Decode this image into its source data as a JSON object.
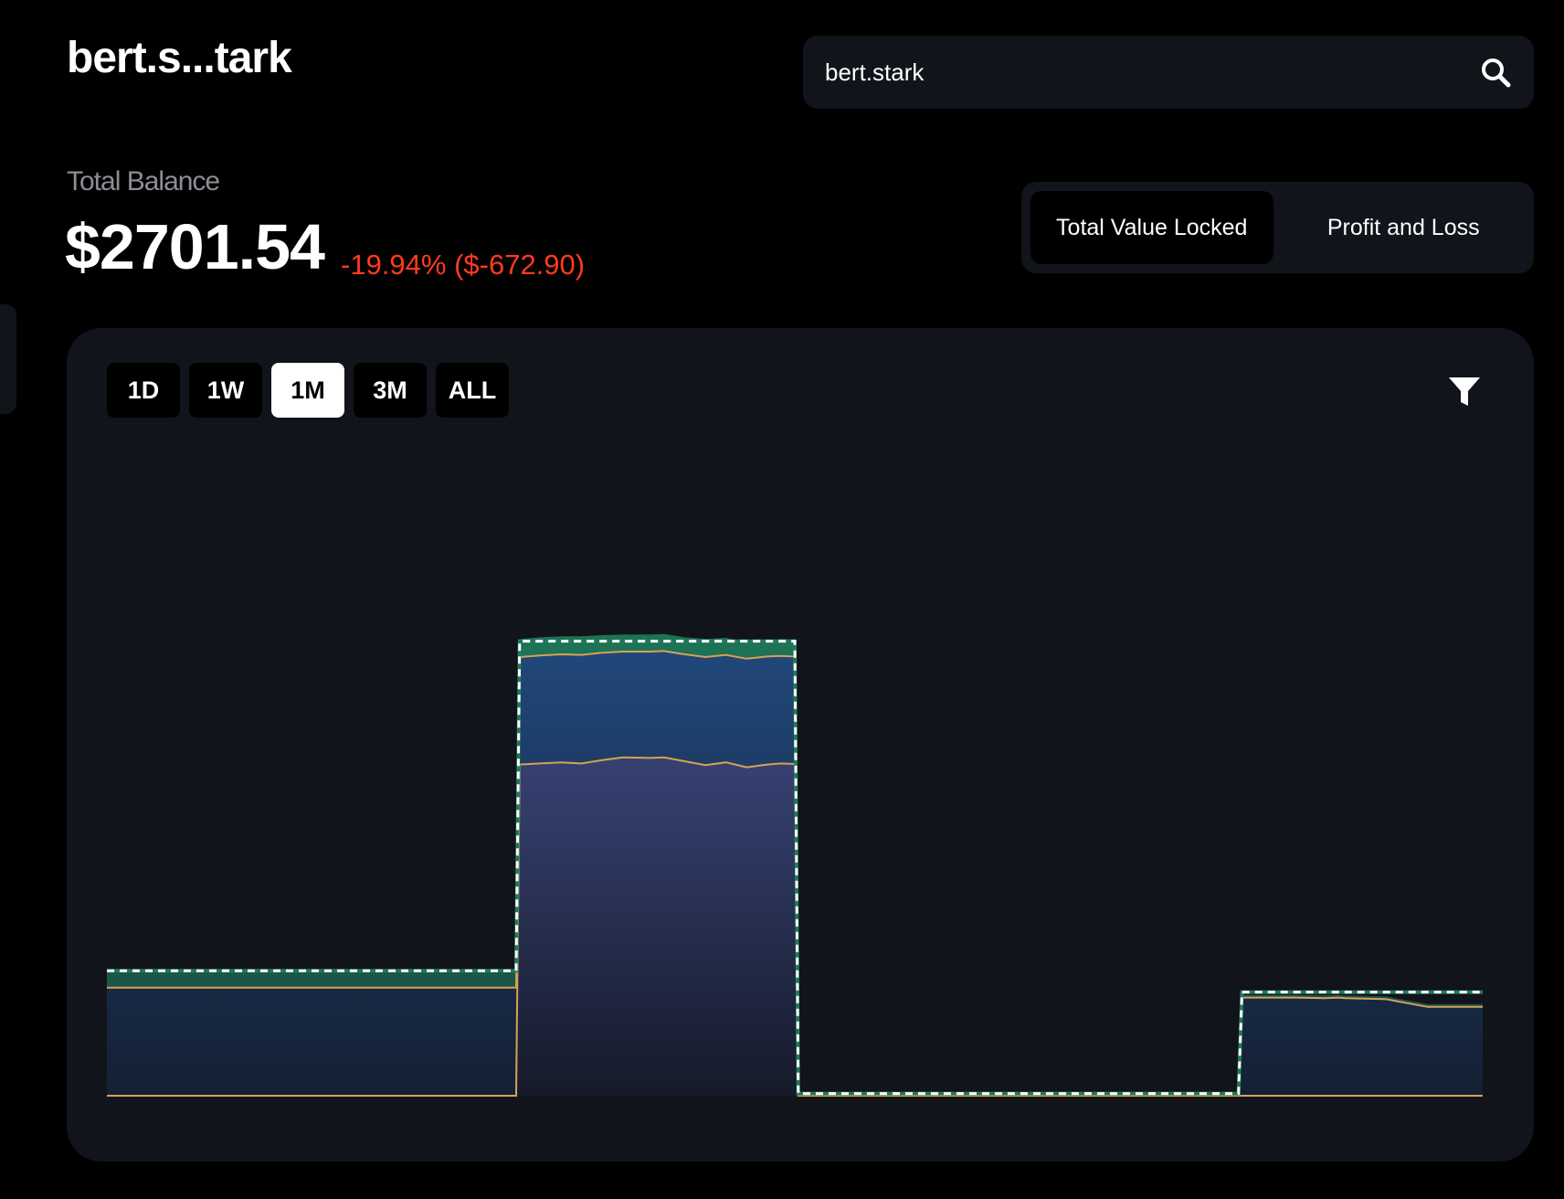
{
  "header": {
    "account_title": "bert.s...tark",
    "search": {
      "value": "bert.stark",
      "icon": "search-icon"
    }
  },
  "balance": {
    "label": "Total Balance",
    "value": "$2701.54",
    "change": "-19.94% ($-672.90)",
    "change_color": "#ff3b1f"
  },
  "view_toggle": {
    "options": [
      "Total Value Locked",
      "Profit and Loss"
    ],
    "selected": "Total Value Locked"
  },
  "ranges": {
    "options": [
      "1D",
      "1W",
      "1M",
      "3M",
      "ALL"
    ],
    "selected": "1M"
  },
  "filter": {
    "icon": "filter-icon"
  },
  "colors": {
    "background": "#000000",
    "card": "#11141a",
    "layer_green": "#1f7a5a",
    "layer_blue": "#24508a",
    "layer_indigo": "#4a5aa0",
    "line_orange": "#d6a255",
    "total_line": "#ffffff"
  },
  "chart_data": {
    "type": "area",
    "stacked": true,
    "x_axis_labels_shown": false,
    "y_axis_labels_shown": false,
    "grid": false,
    "legend": "none",
    "ylim": [
      0,
      100
    ],
    "x": [
      0,
      0.3,
      0.55,
      0.8,
      1,
      1.6,
      2.8,
      3.3,
      3.4,
      3.45,
      3.95,
      4.4,
      4.65,
      4.9,
      5,
      5.25,
      5.45,
      5.7,
      5.95,
      6,
      6.3,
      6.6,
      6.9,
      7.2,
      7.5,
      7.9,
      8.1,
      8.4,
      8.7,
      9,
      9.3,
      9.6,
      9.8,
      10,
      10.05,
      10.4,
      10.8,
      11.3,
      12,
      13,
      14,
      15,
      16,
      16.45,
      16.5,
      16.9,
      17.3,
      17.7,
      17.9,
      18,
      18.3,
      18.6,
      19.2,
      19.6,
      19.7,
      20
    ],
    "series": [
      {
        "values": [
          0,
          0,
          0,
          0,
          0,
          0,
          0,
          0,
          0,
          0,
          0,
          0,
          0,
          0,
          0,
          0,
          0,
          0,
          0,
          60.4,
          60.6,
          60.8,
          60.6,
          61.2,
          61.7,
          61.6,
          61.7,
          61.0,
          60.3,
          60.8,
          59.9,
          60.4,
          60.6,
          60.5,
          0,
          0,
          0,
          0,
          0,
          0,
          0,
          0,
          0,
          0,
          0,
          0,
          0,
          0,
          0,
          0,
          0,
          0,
          0,
          0,
          0,
          0
        ]
      },
      {
        "values": [
          19.7,
          19.7,
          19.7,
          19.7,
          19.7,
          19.7,
          19.7,
          19.7,
          19.7,
          19.7,
          19.7,
          19.7,
          19.7,
          19.7,
          19.7,
          19.7,
          19.7,
          19.7,
          19.7,
          19.6,
          19.7,
          19.7,
          19.8,
          19.6,
          19.3,
          19.4,
          19.4,
          19.5,
          19.7,
          19.6,
          19.8,
          19.7,
          19.6,
          19.6,
          0,
          0,
          0,
          0,
          0,
          0,
          0,
          0,
          0,
          0,
          17.9,
          17.9,
          17.9,
          17.8,
          17.9,
          17.8,
          17.7,
          17.6,
          16.2,
          16.2,
          16.2,
          16.2
        ]
      },
      {
        "values": [
          3.1,
          3.1,
          3.1,
          3.1,
          3.1,
          3.1,
          3.1,
          3.1,
          3.1,
          3.1,
          3.1,
          3.1,
          3.1,
          3.1,
          3.1,
          3.1,
          3.1,
          3.1,
          3.1,
          3.3,
          3.3,
          3.3,
          3.4,
          3.2,
          3.1,
          3.1,
          3.1,
          3.1,
          3.3,
          3.1,
          3.0,
          3.0,
          3.1,
          3.1,
          0.4,
          0.4,
          0.4,
          0.4,
          0.4,
          0.4,
          0.4,
          0.4,
          0.4,
          0.4,
          0.5,
          0.5,
          0.5,
          0.5,
          0.5,
          0.5,
          0.5,
          0.5,
          0.5,
          0.5,
          0.5,
          0.5
        ]
      }
    ],
    "total": [
      22.8,
      22.8,
      22.8,
      22.8,
      22.8,
      22.8,
      22.8,
      22.8,
      22.8,
      22.8,
      22.8,
      22.8,
      22.8,
      22.8,
      22.8,
      22.8,
      22.8,
      22.8,
      22.8,
      82.9,
      82.9,
      82.9,
      82.9,
      82.9,
      82.9,
      82.9,
      82.9,
      82.9,
      82.9,
      82.9,
      82.9,
      82.9,
      82.9,
      82.9,
      0.4,
      0.4,
      0.4,
      0.4,
      0.4,
      0.4,
      0.4,
      0.4,
      0.4,
      0.4,
      18.9,
      18.9,
      18.9,
      18.9,
      18.9,
      18.9,
      18.9,
      18.9,
      18.9,
      18.9,
      18.9,
      18.9
    ]
  }
}
